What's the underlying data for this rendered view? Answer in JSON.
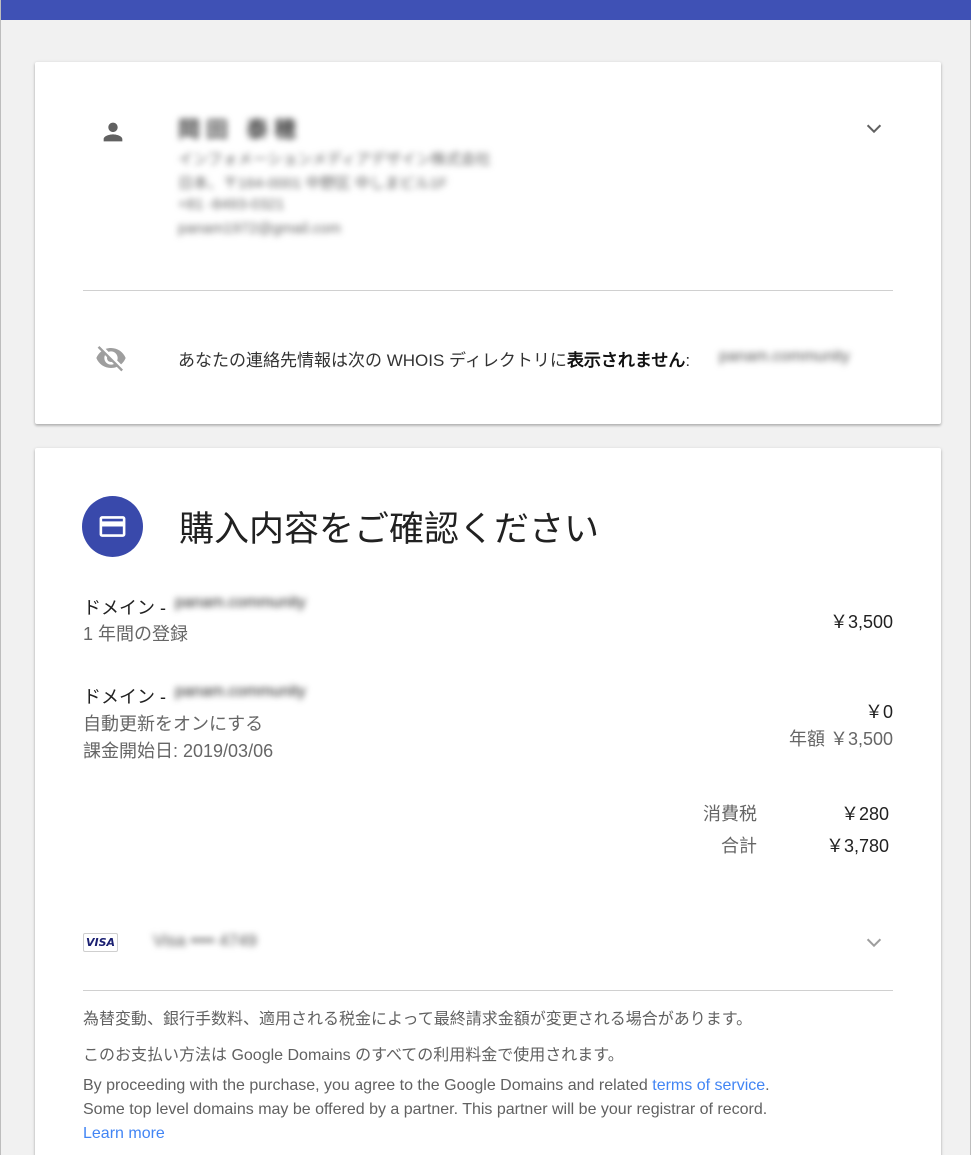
{
  "contact": {
    "name": "岡田 泰穂",
    "company": "インフォメーションメディアデザイン株式会社",
    "address": "日本、〒164-0001 中野区 中しまビル1F",
    "phone": "+81 -8493-0321",
    "email": "panam1972@gmail.com"
  },
  "privacy": {
    "text_before": "あなたの連絡先情報は次の WHOIS ディレクトリに",
    "text_bold": "表示されません",
    "text_after": ":",
    "domain": "panam.community"
  },
  "purchase": {
    "title": "購入内容をご確認ください",
    "items": [
      {
        "label": "ドメイン - ",
        "domain": "panam.community",
        "sub1": "1 年間の登録",
        "price": "￥3,500"
      },
      {
        "label": "ドメイン - ",
        "domain": "panam.community",
        "sub1": "自動更新をオンにする",
        "sub2": "課金開始日: 2019/03/06",
        "price": "￥0",
        "price_sub": "年額 ￥3,500"
      }
    ],
    "tax_label": "消費税",
    "tax_value": "￥280",
    "total_label": "合計",
    "total_value": "￥3,780"
  },
  "payment": {
    "card_brand": "VISA",
    "card_masked": "Visa •••• 4749"
  },
  "notes": {
    "exchange": "為替変動、銀行手数料、適用される税金によって最終請求金額が変更される場合があります。",
    "method": "このお支払い方法は Google Domains のすべての利用料金で使用されます。",
    "terms_before": "By proceeding with the purchase, you agree to the Google Domains and related ",
    "terms_link": "terms of service",
    "terms_after": ".",
    "partner": "Some top level domains may be offered by a partner. This partner will be your registrar of record.",
    "learn_more": "Learn more"
  },
  "colors": {
    "accent": "#3f51b5",
    "icon_circle": "#3949ab",
    "link": "#4285f4"
  }
}
